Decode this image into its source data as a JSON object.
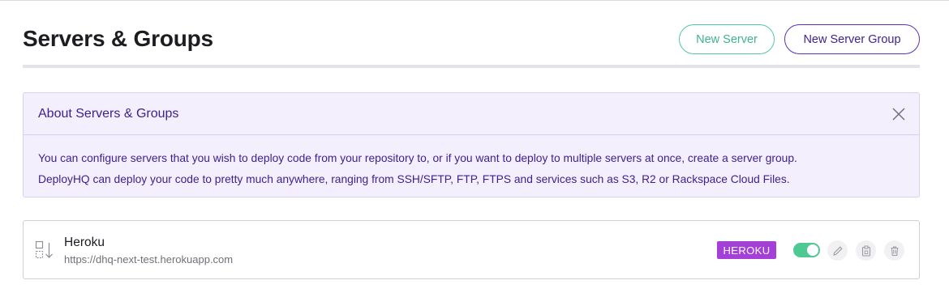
{
  "header": {
    "title": "Servers & Groups",
    "new_server_label": "New Server",
    "new_group_label": "New Server Group"
  },
  "about": {
    "title": "About Servers & Groups",
    "line1": "You can configure servers that you wish to deploy code from your repository to, or if you want to deploy to multiple servers at once, create a server group.",
    "line2": "DeployHQ can deploy your code to pretty much anywhere, ranging from SSH/SFTP, FTP, FTPS and services such as S3, R2 or Rackspace Cloud Files.",
    "close_icon": "close-icon"
  },
  "servers": [
    {
      "name": "Heroku",
      "url": "https://dhq-next-test.herokuapp.com",
      "type_badge": "HEROKU",
      "enabled": true,
      "icons": [
        "server-transfer-icon",
        "pencil-icon",
        "clipboard-icon",
        "trash-icon"
      ]
    }
  ],
  "colors": {
    "accent_purple": "#40208f",
    "accent_green": "#3db58f",
    "badge_heroku": "#a43fd8",
    "toggle_on": "#4fc994",
    "info_bg": "#f3effd"
  }
}
